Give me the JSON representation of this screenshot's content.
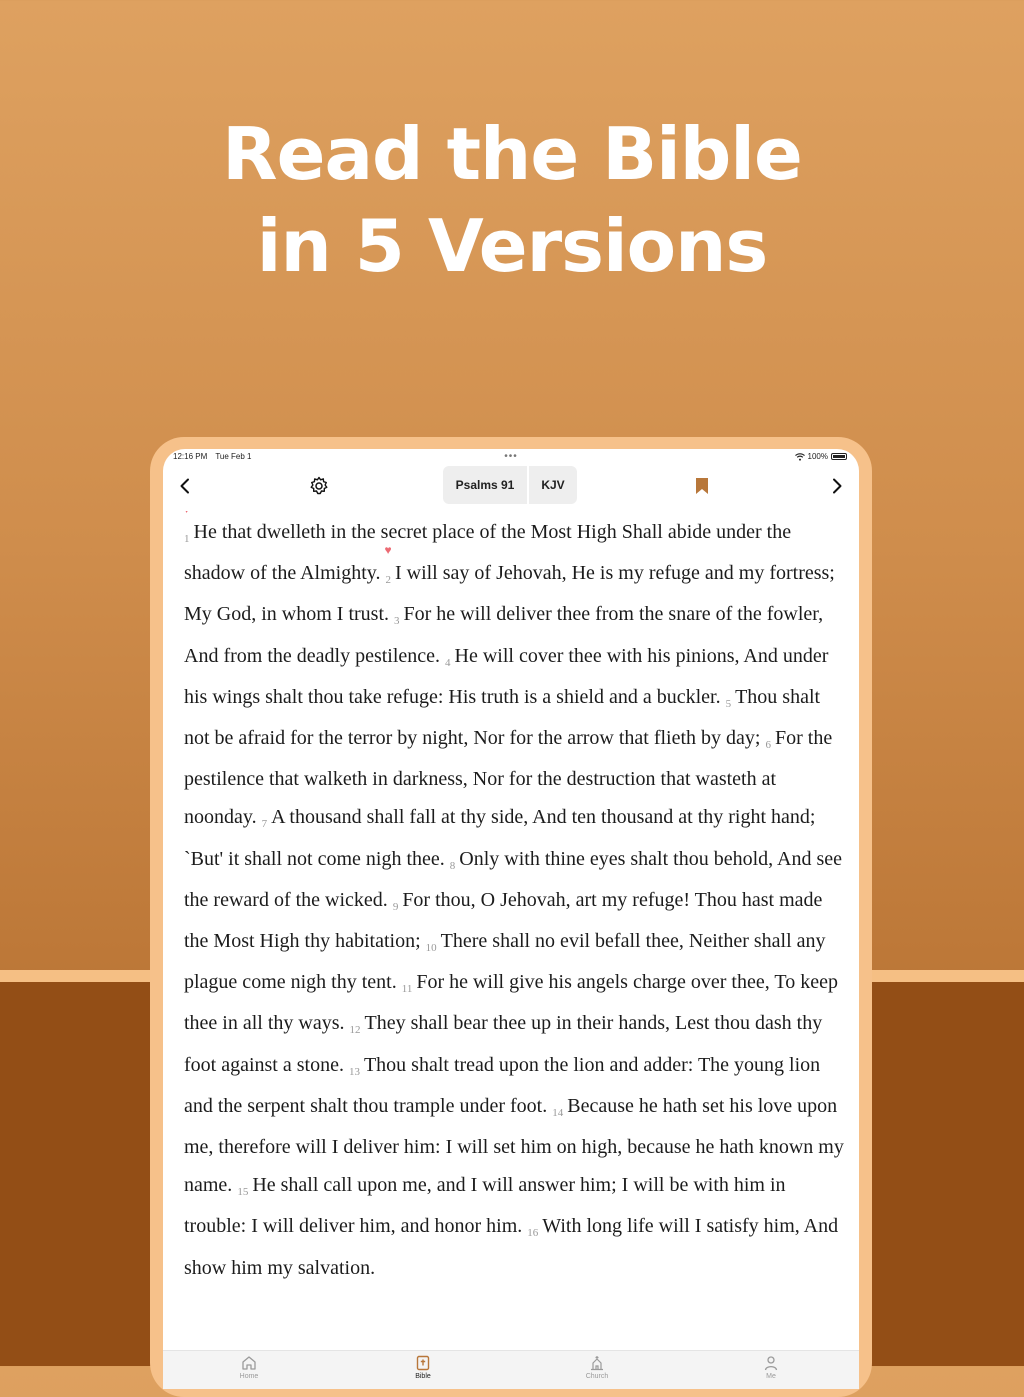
{
  "headline": {
    "line1": "Read the Bible",
    "line2": "in 5 Versions"
  },
  "status": {
    "time": "12:16 PM",
    "date": "Tue Feb 1",
    "battery": "100%"
  },
  "toolbar": {
    "book": "Psalms 91",
    "version": "KJV"
  },
  "colors": {
    "accent": "#b8773a",
    "heart": "#ec6a73",
    "device_frame": "#f6c18a"
  },
  "icons": [
    "back-icon",
    "gear-icon",
    "bookmark-icon",
    "forward-icon",
    "heart-icon",
    "home-icon",
    "bible-icon",
    "church-icon",
    "person-icon"
  ],
  "verses": [
    {
      "n": "1",
      "text": "He that dwelleth in the secret place of the Most High Shall abide under the shadow of the Almighty.",
      "hearted": true
    },
    {
      "n": "2",
      "text": "I will say of Jehovah, He is my refuge and my fortress; My God, in whom I trust.",
      "hearted": true
    },
    {
      "n": "3",
      "text": "For he will deliver thee from the snare of the fowler, And from the deadly pestilence.",
      "hearted": false
    },
    {
      "n": "4",
      "text": "He will cover thee with his pinions, And under his wings shalt thou take refuge: His truth is a shield and a buckler.",
      "hearted": false
    },
    {
      "n": "5",
      "text": "Thou shalt not be afraid for the terror by night, Nor for the arrow that flieth by day;",
      "hearted": false
    },
    {
      "n": "6",
      "text": "For the pestilence that walketh in darkness, Nor for the destruction that wasteth at noonday.",
      "hearted": false
    },
    {
      "n": "7",
      "text": "A thousand shall fall at thy side, And ten thousand at thy right hand; `But' it shall not come nigh thee.",
      "hearted": false
    },
    {
      "n": "8",
      "text": "Only with thine eyes shalt thou behold, And see the reward of the wicked.",
      "hearted": false
    },
    {
      "n": "9",
      "text": "For thou, O Jehovah, art my refuge! Thou hast made the Most High thy habitation;",
      "hearted": false
    },
    {
      "n": "10",
      "text": "There shall no evil befall thee, Neither shall any plague come nigh thy tent.",
      "hearted": false
    },
    {
      "n": "11",
      "text": "For he will give his angels charge over thee, To keep thee in all thy ways.",
      "hearted": false
    },
    {
      "n": "12",
      "text": "They shall bear thee up in their hands, Lest thou dash thy foot against a stone.",
      "hearted": false
    },
    {
      "n": "13",
      "text": "Thou shalt tread upon the lion and adder: The young lion and the serpent shalt thou trample under foot.",
      "hearted": false
    },
    {
      "n": "14",
      "text": "Because he hath set his love upon me, therefore will I deliver him: I will set him on high, because he hath known my name.",
      "hearted": false
    },
    {
      "n": "15",
      "text": "He shall call upon me, and I will answer him; I will be with him in trouble: I will deliver him, and honor him.",
      "hearted": false
    },
    {
      "n": "16",
      "text": "With long life will I satisfy him, And show him my salvation.",
      "hearted": false
    }
  ],
  "tabs": {
    "home": "Home",
    "bible": "Bible",
    "church": "Church",
    "me": "Me"
  }
}
